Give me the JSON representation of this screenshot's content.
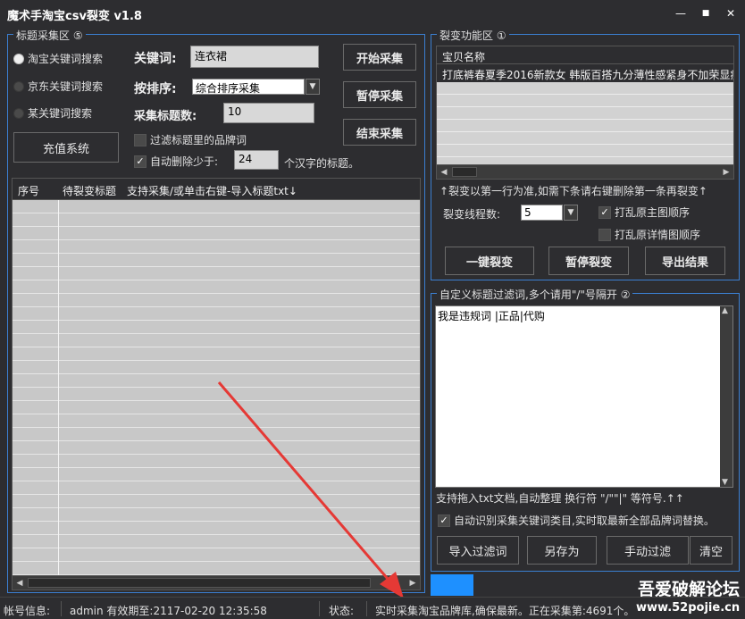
{
  "window": {
    "title": "魔术手淘宝csv裂变 v1.8",
    "buttons": {
      "minimize": "—",
      "maximize": "■",
      "close": "✕"
    }
  },
  "collect": {
    "group_title": "标题采集区 ⑤",
    "radios": [
      {
        "label": "淘宝关键词搜索",
        "selected": true
      },
      {
        "label": "京东关键词搜索",
        "selected": false
      },
      {
        "label": "某关键词搜索",
        "selected": false
      }
    ],
    "recharge_button": "充值系统",
    "keyword_label": "关键词:",
    "keyword_value": "连衣裙",
    "sort_label": "按排序:",
    "sort_value": "综合排序采集",
    "count_label": "采集标题数:",
    "count_value": "10",
    "filter_brand_label": "过滤标题里的品牌词",
    "filter_brand_checked": false,
    "auto_delete_label": "自动删除少于:",
    "auto_delete_checked": true,
    "auto_delete_value": "24",
    "auto_delete_suffix": "个汉字的标题。",
    "start_button": "开始采集",
    "pause_button": "暂停采集",
    "stop_button": "结束采集",
    "table_headers": {
      "index": "序号",
      "title": "待裂变标题",
      "hint": "支持采集/或单击右键-导入标题txt↓"
    }
  },
  "fission": {
    "group_title": "裂变功能区 ①",
    "list_header": "宝贝名称",
    "list_rows": [
      "打底裤春夏季2016新款女 韩版百搭九分薄性感紧身不加荣显瘦"
    ],
    "hint": "↑裂变以第一行为准,如需下条请右键删除第一条再裂变↑",
    "threads_label": "裂变线程数:",
    "threads_value": "5",
    "shuffle_main_label": "打乱原主图顺序",
    "shuffle_main_checked": true,
    "shuffle_detail_label": "打乱原详情图顺序",
    "shuffle_detail_checked": false,
    "one_click_button": "一键裂变",
    "pause_button": "暂停裂变",
    "export_button": "导出结果"
  },
  "filter": {
    "group_title": "自定义标题过滤词,多个请用\"/\"号隔开 ②",
    "text": "我是违规词 |正品|代购",
    "hint": "支持拖入txt文档,自动整理 换行符 \"/\"\"|\" 等符号.↑↑",
    "auto_identify_label": "自动识别采集关键词类目,实时取最新全部品牌词替换。",
    "auto_identify_checked": true,
    "import_button": "导入过滤词",
    "save_as_button": "另存为",
    "manual_button": "手动过滤",
    "clear_button": "清空"
  },
  "status": {
    "account_label": "帐号信息:",
    "account_value": "admin 有效期至:2117-02-20 12:35:58",
    "state_label": "状态:",
    "state_value": "实时采集淘宝品牌库,确保最新。正在采集第:4691个。",
    "progress": 0.14
  },
  "watermark": {
    "line1": "吾爱破解论坛",
    "line2": "www.52pojie.cn"
  },
  "colors": {
    "accent": "#3b7fd1",
    "progress": "#1e90ff",
    "arrow": "#e53935"
  }
}
